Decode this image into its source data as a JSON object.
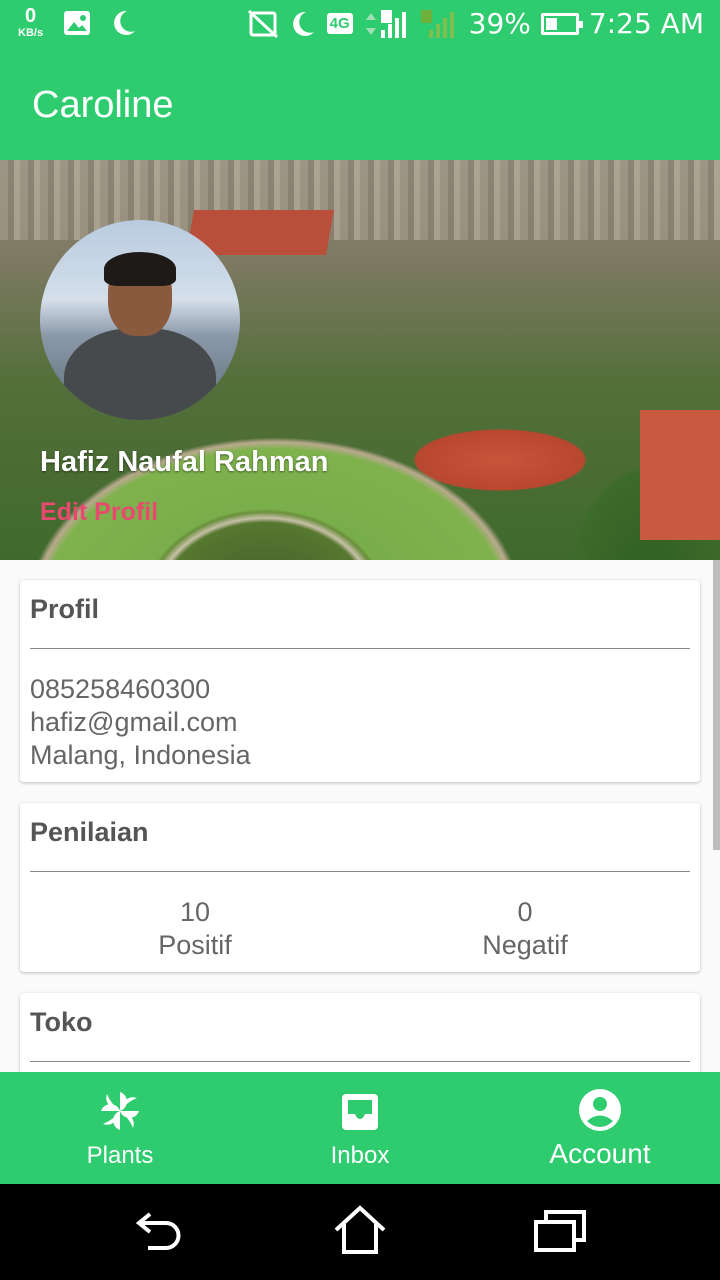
{
  "status_bar": {
    "speed_value": "0",
    "speed_unit": "KB/s",
    "network": "4G",
    "battery": "39%",
    "battery_level": 0.39,
    "time": "7:25 AM"
  },
  "app_bar": {
    "title": "Caroline"
  },
  "profile_header": {
    "name": "Hafiz Naufal Rahman",
    "edit_label": "Edit Profil"
  },
  "profil_card": {
    "title": "Profil",
    "phone": "085258460300",
    "email": "hafiz@gmail.com",
    "location": "Malang, Indonesia"
  },
  "penilaian_card": {
    "title": "Penilaian",
    "positive_value": "10",
    "positive_label": "Positif",
    "negative_value": "0",
    "negative_label": "Negatif"
  },
  "toko_card": {
    "title": "Toko"
  },
  "bottom_nav": {
    "items": [
      {
        "label": "Plants",
        "icon": "pinwheel-icon"
      },
      {
        "label": "Inbox",
        "icon": "inbox-icon"
      },
      {
        "label": "Account",
        "icon": "account-icon"
      }
    ],
    "active": "Account"
  },
  "colors": {
    "primary": "#2ecc6e",
    "accent": "#e84a6f"
  }
}
